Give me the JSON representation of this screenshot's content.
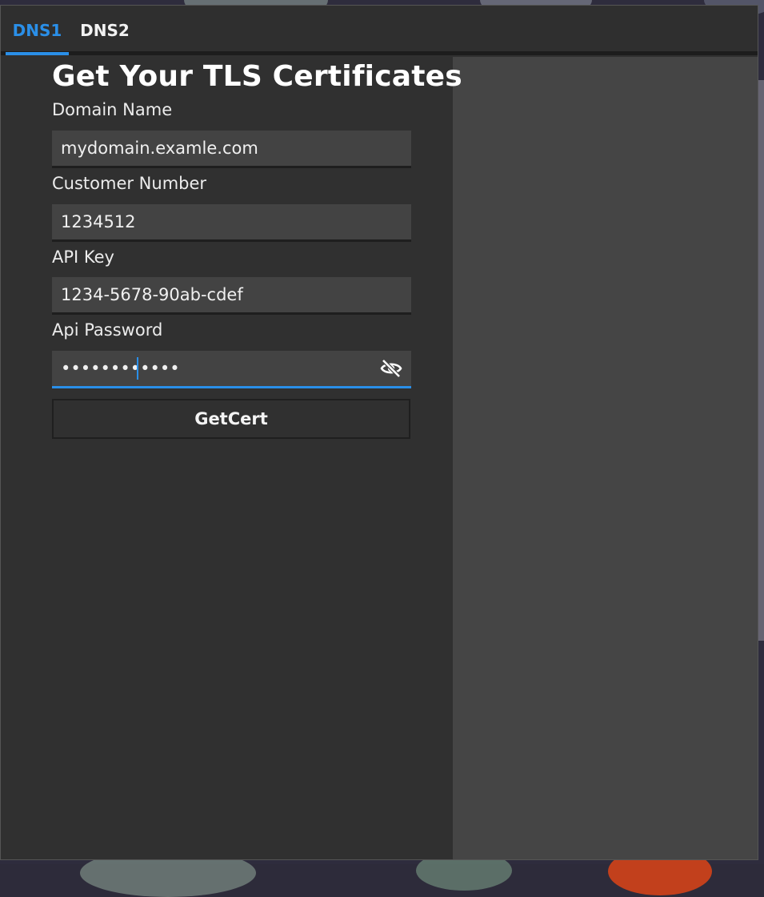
{
  "tabs": [
    {
      "label": "DNS1",
      "active": true
    },
    {
      "label": "DNS2",
      "active": false
    }
  ],
  "form": {
    "title": "Get Your TLS Certificates",
    "domain": {
      "label": "Domain Name",
      "value": "mydomain.examle.com"
    },
    "customer": {
      "label": "Customer Number",
      "value": "1234512"
    },
    "api_key": {
      "label": "API Key",
      "value": "1234-5678-90ab-cdef"
    },
    "api_password": {
      "label": "Api Password",
      "value": "••••••••••••",
      "toggle_icon": "eye-off-icon"
    },
    "submit_label": "GetCert"
  },
  "colors": {
    "accent": "#2a8fe8",
    "window_bg": "#303030",
    "input_bg": "#434343",
    "side_panel_bg": "#454545"
  }
}
